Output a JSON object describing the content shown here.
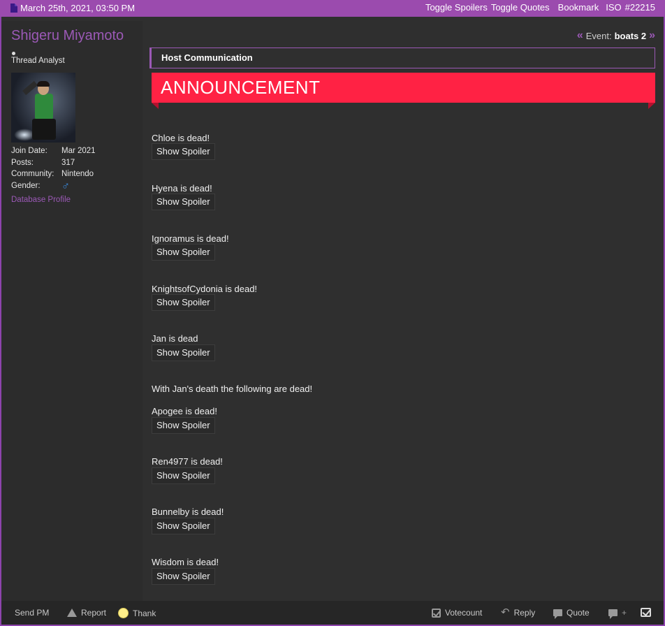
{
  "header": {
    "date": "March 25th, 2021, 03:50 PM",
    "toggle_spoilers": "Toggle Spoilers",
    "toggle_quotes": "Toggle Quotes",
    "bookmark": "Bookmark",
    "iso": "ISO",
    "post_number": "#22215"
  },
  "user": {
    "name": "Shigeru Miyamoto",
    "title": "Thread Analyst",
    "stats": [
      {
        "label": "Join Date:",
        "value": "Mar 2021"
      },
      {
        "label": "Posts:",
        "value": "317"
      },
      {
        "label": "Community:",
        "value": "Nintendo"
      },
      {
        "label": "Gender:",
        "value": "♂"
      }
    ],
    "db_profile": "Database Profile"
  },
  "event": {
    "label": "Event:",
    "name": "boats 2"
  },
  "post": {
    "host_label": "Host Communication",
    "banner": "ANNOUNCEMENT",
    "spoiler_label": "Show Spoiler",
    "entries": [
      {
        "text": "Chloe is dead!"
      },
      {
        "text": "Hyena is dead!"
      },
      {
        "text": "Ignoramus is dead!"
      },
      {
        "text": "KnightsofCydonia is dead!"
      },
      {
        "text": "Jan is dead"
      },
      {
        "text": "With Jan's death the following are dead!"
      },
      {
        "text": "Apogee is dead!"
      },
      {
        "text": "Ren4977 is dead!"
      },
      {
        "text": "Bunnelby is dead!"
      },
      {
        "text": "Wisdom is dead!"
      }
    ]
  },
  "footer": {
    "send_pm": "Send PM",
    "report": "Report",
    "thank": "Thank",
    "votecount": "Votecount",
    "reply": "Reply",
    "quote": "Quote"
  },
  "colors": {
    "accent": "#9b59b6",
    "banner": "#ff2244",
    "background": "#2f2f2f"
  }
}
